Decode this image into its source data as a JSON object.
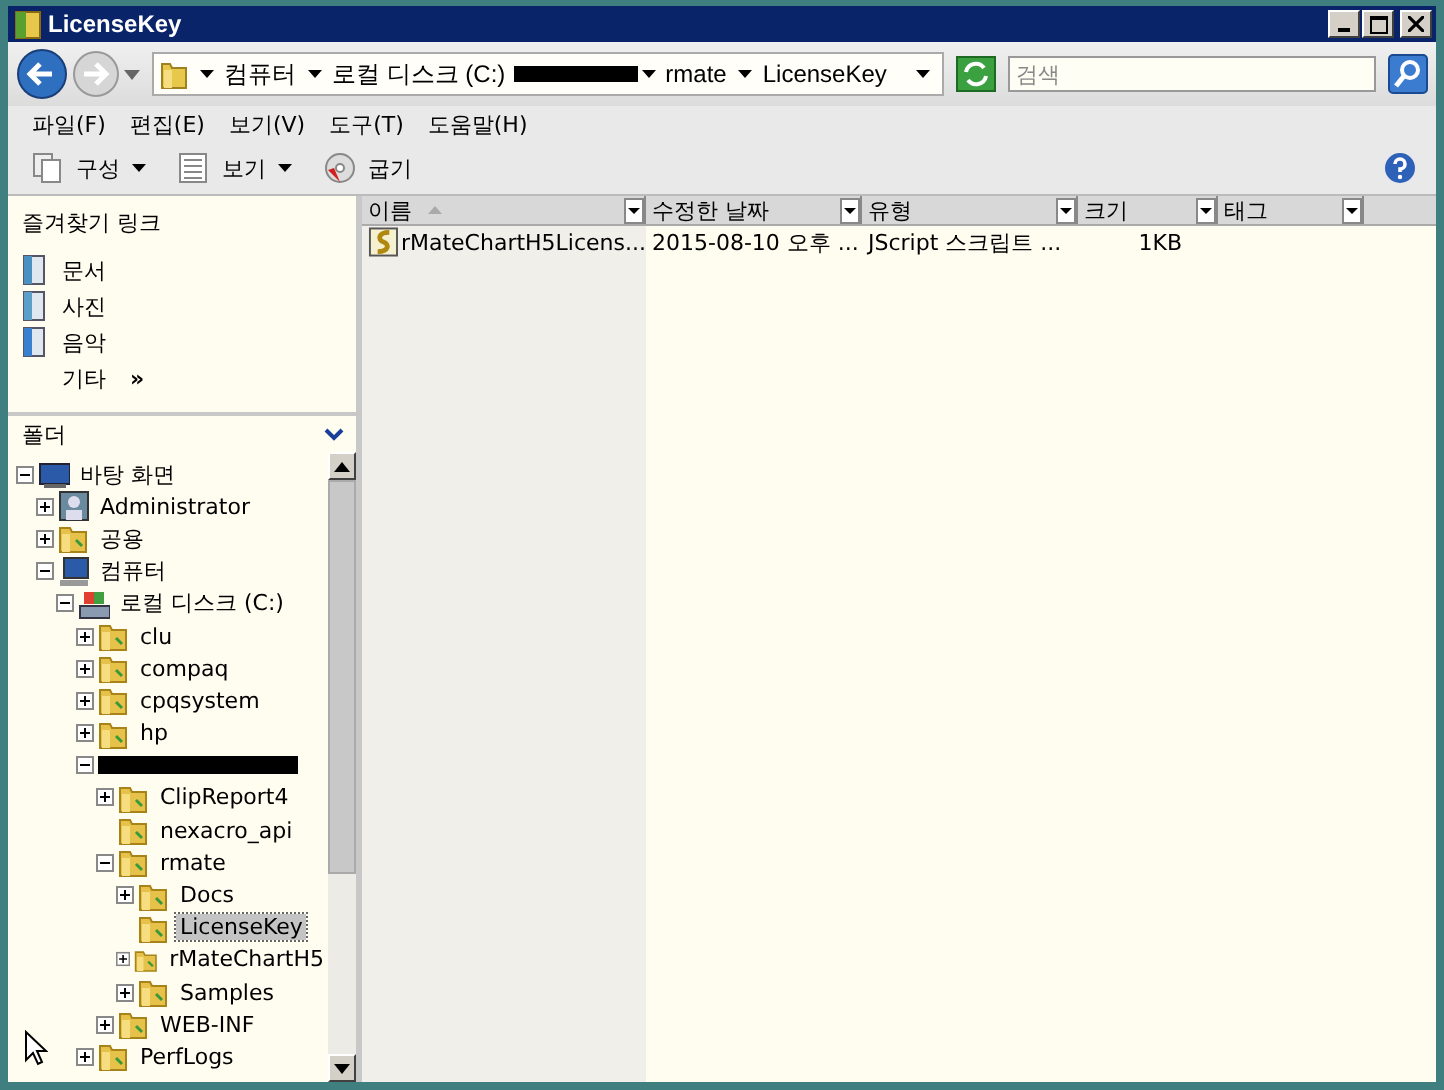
{
  "window": {
    "title": "LicenseKey"
  },
  "address_bar": {
    "segments": [
      {
        "kind": "folder",
        "label": "컴퓨터"
      },
      {
        "kind": "folder",
        "label": "로컬 디스크 (C:)"
      },
      {
        "kind": "redacted"
      },
      {
        "kind": "folder",
        "label": "rmate"
      },
      {
        "kind": "folder",
        "label": "LicenseKey"
      }
    ],
    "search_placeholder": "검색"
  },
  "menu": [
    "파일(F)",
    "편집(E)",
    "보기(V)",
    "도구(T)",
    "도움말(H)"
  ],
  "toolbar": [
    {
      "label": "구성",
      "kind": "organize",
      "dropdown": true
    },
    {
      "label": "보기",
      "kind": "views",
      "dropdown": true
    },
    {
      "label": "굽기",
      "kind": "burn",
      "dropdown": false
    }
  ],
  "favorites": {
    "title": "즐겨찾기 링크",
    "items": [
      {
        "label": "문서",
        "kind": "documents"
      },
      {
        "label": "사진",
        "kind": "pictures"
      },
      {
        "label": "음악",
        "kind": "music"
      }
    ],
    "more": "기타",
    "more_mark": "»"
  },
  "folders": {
    "title": "폴더",
    "tree": [
      {
        "label": "바탕 화면",
        "kind": "desktop",
        "expander": true,
        "expanded": true,
        "selected": false,
        "children": [
          {
            "label": "Administrator",
            "kind": "user",
            "expander": true,
            "expanded": false,
            "selected": false
          },
          {
            "label": "공용",
            "kind": "folder",
            "expander": true,
            "expanded": false,
            "selected": false
          },
          {
            "label": "컴퓨터",
            "kind": "computer",
            "expander": true,
            "expanded": true,
            "selected": false,
            "children": [
              {
                "label": "로컬 디스크 (C:)",
                "kind": "drive",
                "expander": true,
                "expanded": true,
                "selected": false,
                "children": [
                  {
                    "label": "clu",
                    "kind": "folder",
                    "expander": true,
                    "expanded": false,
                    "selected": false
                  },
                  {
                    "label": "compaq",
                    "kind": "folder",
                    "expander": true,
                    "expanded": false,
                    "selected": false
                  },
                  {
                    "label": "cpqsystem",
                    "kind": "folder",
                    "expander": true,
                    "expanded": false,
                    "selected": false
                  },
                  {
                    "label": "hp",
                    "kind": "folder",
                    "expander": true,
                    "expanded": false,
                    "selected": false
                  },
                  {
                    "kind": "redacted",
                    "expander": true,
                    "expanded": true,
                    "selected": false,
                    "children": [
                      {
                        "label": "ClipReport4",
                        "kind": "folder",
                        "expander": true,
                        "expanded": false,
                        "selected": false
                      },
                      {
                        "label": "nexacro_api",
                        "kind": "folder",
                        "expander": false,
                        "selected": false
                      },
                      {
                        "label": "rmate",
                        "kind": "folder",
                        "expander": true,
                        "expanded": true,
                        "selected": false,
                        "children": [
                          {
                            "label": "Docs",
                            "kind": "folder",
                            "expander": true,
                            "expanded": false,
                            "selected": false
                          },
                          {
                            "label": "LicenseKey",
                            "kind": "folder",
                            "expander": false,
                            "selected": true
                          },
                          {
                            "label": "rMateChartH5",
                            "kind": "folder",
                            "expander": true,
                            "expanded": false,
                            "selected": false
                          },
                          {
                            "label": "Samples",
                            "kind": "folder",
                            "expander": true,
                            "expanded": false,
                            "selected": false
                          }
                        ]
                      },
                      {
                        "label": "WEB-INF",
                        "kind": "folder",
                        "expander": true,
                        "expanded": false,
                        "selected": false
                      }
                    ]
                  },
                  {
                    "label": "PerfLogs",
                    "kind": "folder",
                    "expander": true,
                    "expanded": false,
                    "selected": false
                  }
                ]
              }
            ]
          }
        ]
      }
    ]
  },
  "table": {
    "columns": [
      {
        "label": "이름",
        "sorted": true
      },
      {
        "label": "수정한 날짜",
        "sorted": false
      },
      {
        "label": "유형",
        "sorted": false
      },
      {
        "label": "크기",
        "sorted": false
      },
      {
        "label": "태그",
        "sorted": false
      }
    ],
    "rows": [
      {
        "name": "rMateChartH5Licens...",
        "modified": "2015-08-10 오후 ...",
        "type": "JScript 스크립트 ...",
        "size": "1KB",
        "selected": false
      }
    ]
  }
}
